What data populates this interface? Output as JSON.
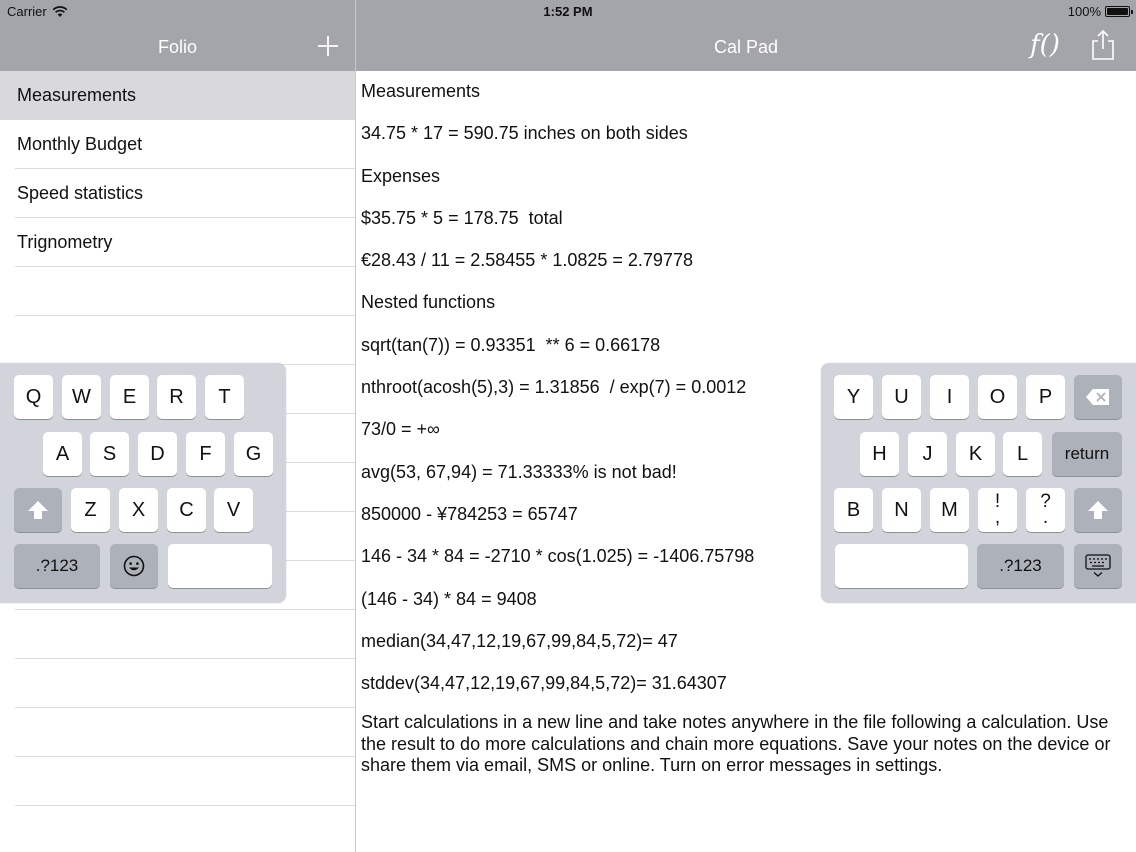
{
  "status_bar": {
    "carrier": "Carrier",
    "time": "1:52 PM",
    "battery": "100%"
  },
  "sidebar": {
    "title": "Folio",
    "add_icon": "plus-icon",
    "items": [
      {
        "label": "Measurements",
        "selected": true
      },
      {
        "label": "Monthly Budget",
        "selected": false
      },
      {
        "label": "Speed statistics",
        "selected": false
      },
      {
        "label": "Trignometry",
        "selected": false
      }
    ]
  },
  "main": {
    "title": "Cal Pad",
    "function_icon": "function-icon",
    "function_label": "f()",
    "share_icon": "share-icon",
    "lines": [
      "Measurements",
      "34.75 * 17 = 590.75 inches on both sides",
      "Expenses",
      "$35.75 * 5 = 178.75  total",
      "€28.43 / 11 = 2.58455 * 1.0825 = 2.79778",
      "Nested functions",
      "sqrt(tan(7)) = 0.93351  ** 6 = 0.66178",
      "nthroot(acosh(5),3) = 1.31856  / exp(7) = 0.0012",
      "73/0 = +∞",
      "avg(53, 67,94) = 71.33333% is not bad!",
      "850000 - ¥784253 = 65747",
      "146 - 34 * 84 = -2710 * cos(1.025) = -1406.75798",
      "(146 - 34) * 84 = 9408",
      "median(34,47,12,19,67,99,84,5,72)= 47",
      "stddev(34,47,12,19,67,99,84,5,72)= 31.64307"
    ],
    "paragraph": "Start calculations in a new line and take notes anywhere in the file following a calculation. Use the result to do more calculations and chain more equations. Save your notes on the device or share them via email, SMS or online. Turn on error messages in settings."
  },
  "keyboard_left": {
    "row1": [
      "Q",
      "W",
      "E",
      "R",
      "T"
    ],
    "row2": [
      "A",
      "S",
      "D",
      "F",
      "G"
    ],
    "row3": [
      "Z",
      "X",
      "C",
      "V"
    ],
    "numbers_label": ".?123",
    "shift_icon": "shift-icon",
    "emoji_icon": "emoji-icon"
  },
  "keyboard_right": {
    "row1": [
      "Y",
      "U",
      "I",
      "O",
      "P"
    ],
    "row2": [
      "H",
      "J",
      "K",
      "L"
    ],
    "row3": [
      "B",
      "N",
      "M"
    ],
    "punct1_top": "!",
    "punct1_bottom": ",",
    "punct2_top": "?",
    "punct2_bottom": ".",
    "return_label": "return",
    "numbers_label": ".?123",
    "backspace_icon": "backspace-icon",
    "shift_icon": "shift-icon",
    "dismiss_icon": "keyboard-dismiss-icon"
  }
}
